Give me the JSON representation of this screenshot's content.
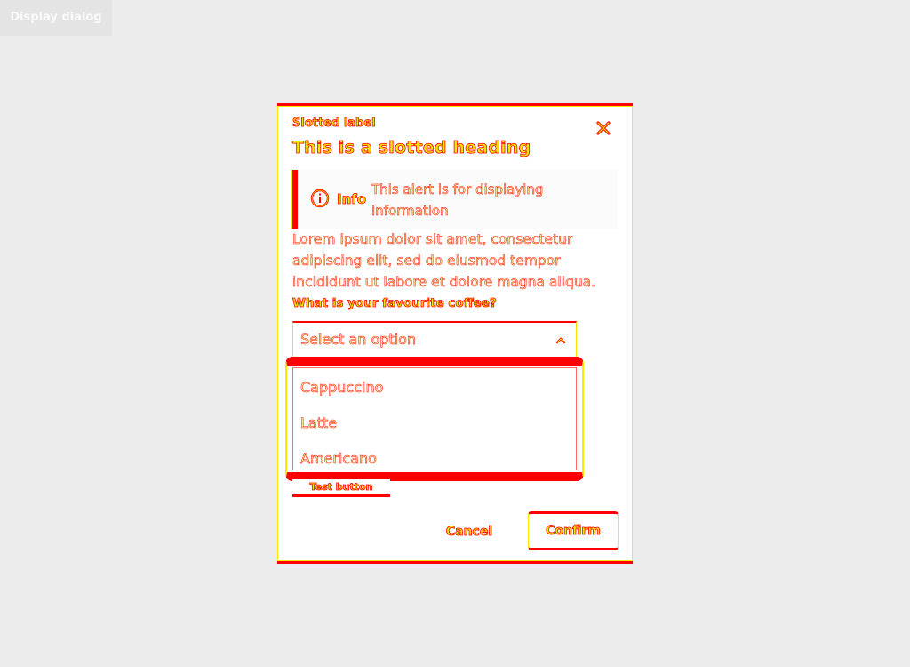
{
  "page": {
    "display_button_label": "Display dialog"
  },
  "dialog": {
    "label": "Slotted label",
    "heading": "This is a slotted heading",
    "close_icon": "close-icon",
    "alert": {
      "icon": "info-circle-icon",
      "title": "Info",
      "text": "This alert is for displaying information"
    },
    "body": "Lorem ipsum dolor sit amet, consectetur adipiscing elit, sed do eiusmod tempor incididunt ut labore et dolore magna aliqua.",
    "select": {
      "label": "What is your favourite coffee?",
      "placeholder": "Select an option",
      "chevron_icon": "chevron-up-icon",
      "options": [
        "Cappuccino",
        "Latte",
        "Americano"
      ]
    },
    "test_button_label": "Test button",
    "cancel_label": "Cancel",
    "confirm_label": "Confirm"
  },
  "colors": {
    "background": "#ececec",
    "accent_red": "#ff0000",
    "accent_yellow": "#f2e500",
    "surface": "#ffffff"
  }
}
